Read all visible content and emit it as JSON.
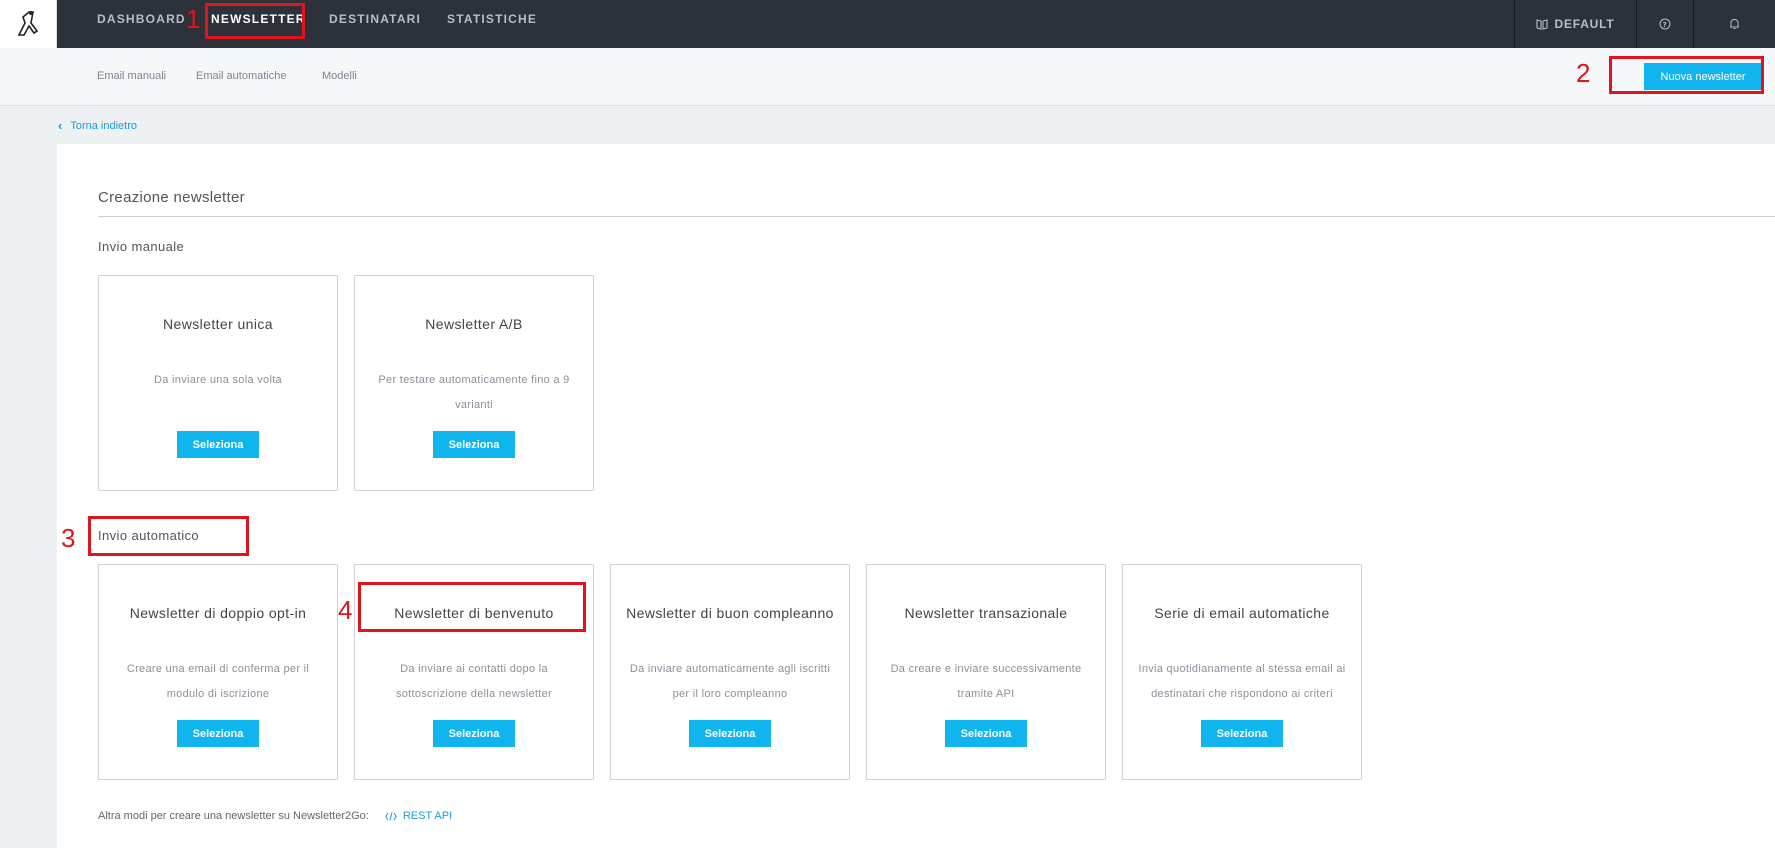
{
  "nav": {
    "items": [
      "DASHBOARD",
      "NEWSLETTER",
      "DESTINATARI",
      "STATISTICHE"
    ],
    "active": "NEWSLETTER",
    "right": {
      "default_label": "DEFAULT"
    }
  },
  "subnav": {
    "items": [
      "Email manuali",
      "Email automatiche",
      "Modelli"
    ],
    "new_button": "Nuova newsletter"
  },
  "back_link": "Torna indietro",
  "page_title": "Creazione newsletter",
  "manual": {
    "title": "Invio manuale",
    "cards": [
      {
        "title": "Newsletter unica",
        "desc": "Da inviare una sola volta",
        "button": "Seleziona"
      },
      {
        "title": "Newsletter A/B",
        "desc": "Per testare automaticamente fino a 9 varianti",
        "button": "Seleziona"
      }
    ]
  },
  "automatic": {
    "title": "Invio automatico",
    "cards": [
      {
        "title": "Newsletter di doppio opt-in",
        "desc": "Creare una email di conferma per il modulo di iscrizione",
        "button": "Seleziona"
      },
      {
        "title": "Newsletter di benvenuto",
        "desc": "Da inviare ai contatti dopo la sottoscrizione della newsletter",
        "button": "Seleziona"
      },
      {
        "title": "Newsletter di buon compleanno",
        "desc": "Da inviare automaticamente agli iscritti per il loro compleanno",
        "button": "Seleziona"
      },
      {
        "title": "Newsletter transazionale",
        "desc": "Da creare e inviare successivamente tramite API",
        "button": "Seleziona"
      },
      {
        "title": "Serie di email automatiche",
        "desc": "Invia quotidianamente al stessa email ai destinatari che rispondono ai criteri",
        "button": "Seleziona"
      }
    ]
  },
  "footer": {
    "text": "Altra modi per creare una newsletter su Newsletter2Go:",
    "link": "REST API"
  },
  "annotations": [
    "1",
    "2",
    "3",
    "4"
  ],
  "colors": {
    "accent": "#11b5ee",
    "topbar": "#2d3139",
    "annotation": "#e0141e"
  }
}
